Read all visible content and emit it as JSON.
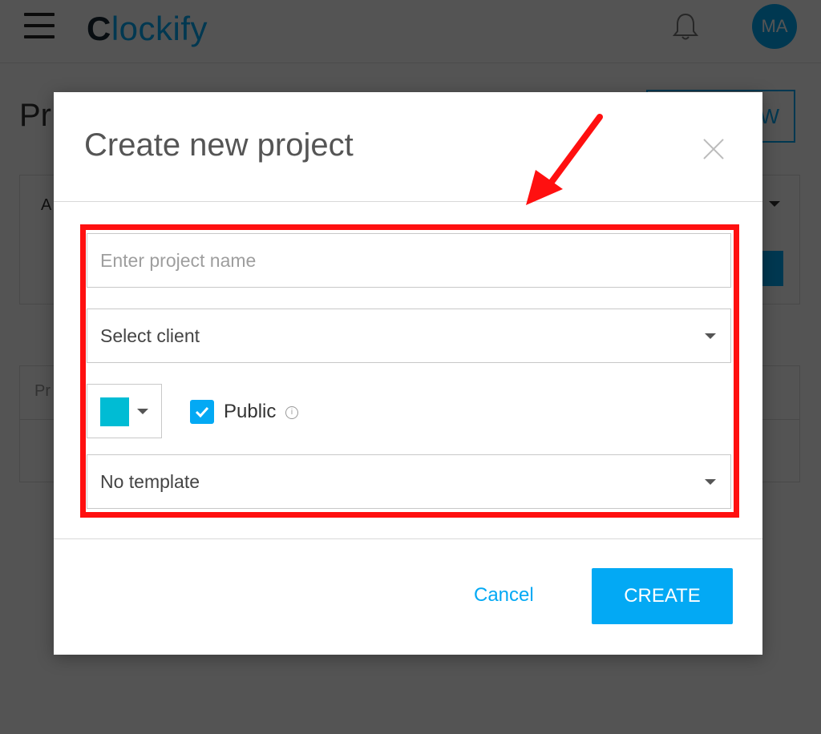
{
  "app": {
    "logo_text": "lockify",
    "logo_prefix": "C",
    "avatar_initials": "MA",
    "page_title_partial": "Pr",
    "bg_button_partial": "W",
    "bg_filter_letter": "A",
    "bg_table_partial": "Pr"
  },
  "modal": {
    "title": "Create new project",
    "name_placeholder": "Enter project name",
    "client_select": "Select client",
    "color_value": "#00bcd4",
    "public_label": "Public",
    "public_checked": true,
    "template_select": "No template",
    "cancel_label": "Cancel",
    "create_label": "CREATE"
  },
  "colors": {
    "accent": "#03a9f4",
    "annotation": "#ff1010"
  },
  "icons": {
    "menu": "hamburger-icon",
    "notifications": "bell-icon",
    "close": "close-icon",
    "dropdown": "caret-down-icon",
    "info": "info-icon",
    "check": "checkmark-icon"
  }
}
